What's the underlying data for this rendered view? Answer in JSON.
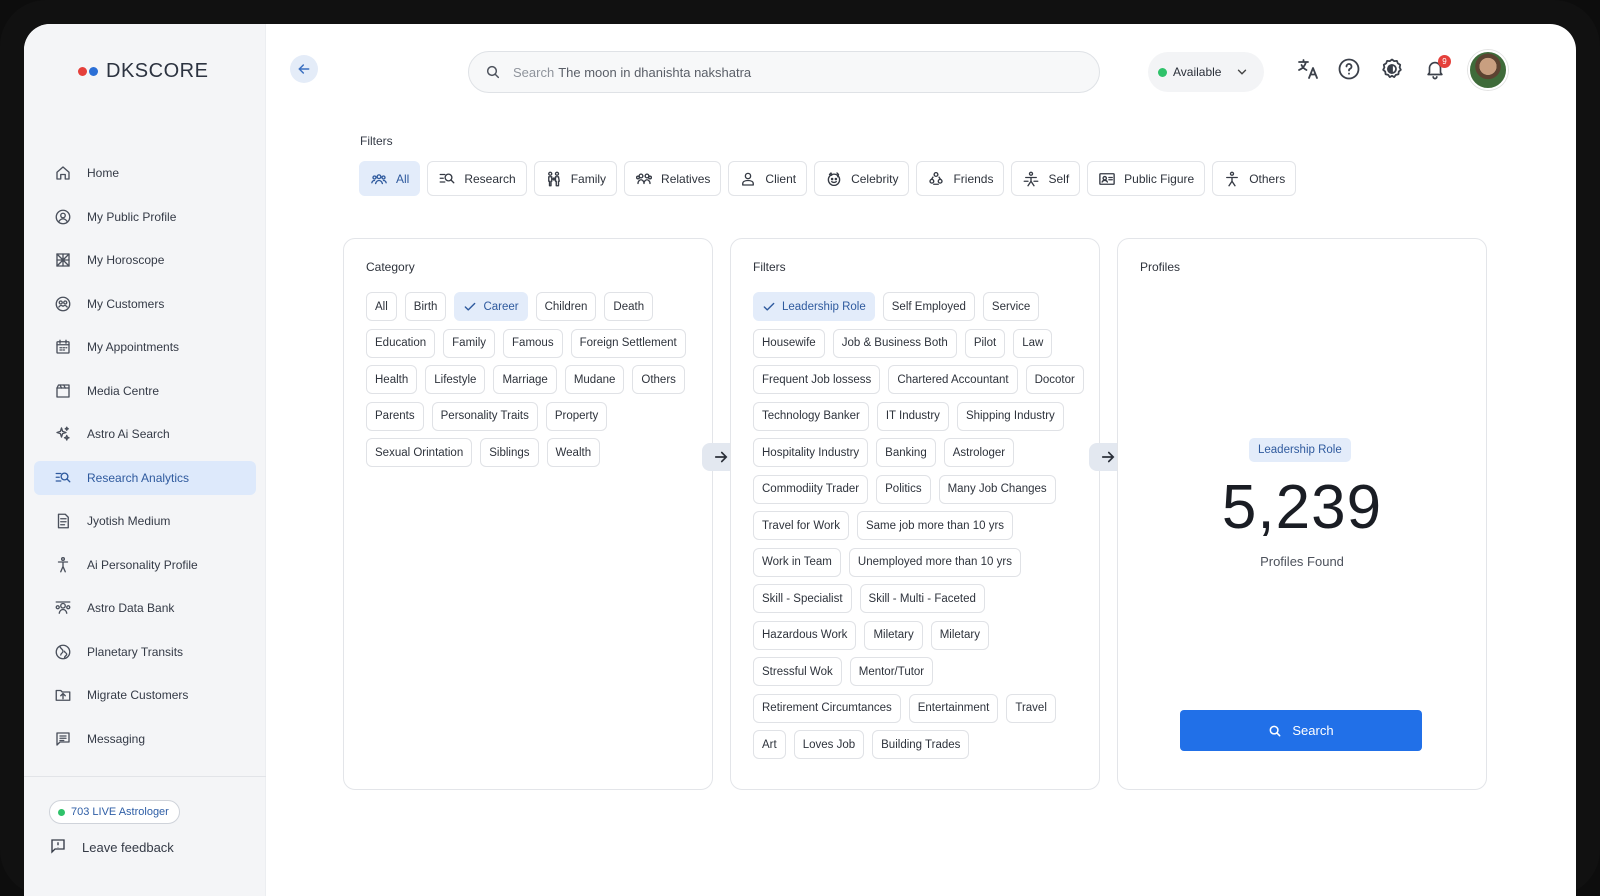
{
  "brand": {
    "name": "DKSCORE",
    "colors": [
      "#e5403b",
      "#2b6fd6"
    ]
  },
  "sidebar": {
    "items": [
      {
        "label": "Home",
        "icon": "home-icon",
        "active": false
      },
      {
        "label": "My Public Profile",
        "icon": "user-circle-icon",
        "active": false
      },
      {
        "label": "My Horoscope",
        "icon": "horoscope-grid-icon",
        "active": false
      },
      {
        "label": "My Customers",
        "icon": "customers-icon",
        "active": false
      },
      {
        "label": "My Appointments",
        "icon": "calendar-icon",
        "active": false
      },
      {
        "label": "Media Centre",
        "icon": "clapperboard-icon",
        "active": false
      },
      {
        "label": "Astro Ai Search",
        "icon": "sparkles-icon",
        "active": false
      },
      {
        "label": "Research Analytics",
        "icon": "research-search-icon",
        "active": true
      },
      {
        "label": "Jyotish Medium",
        "icon": "document-icon",
        "active": false
      },
      {
        "label": "Ai Personality Profile",
        "icon": "person-standing-icon",
        "active": false
      },
      {
        "label": "Astro Data Bank",
        "icon": "data-bank-icon",
        "active": false
      },
      {
        "label": "Planetary Transits",
        "icon": "globe-icon",
        "active": false
      },
      {
        "label": "Migrate Customers",
        "icon": "folder-upload-icon",
        "active": false
      },
      {
        "label": "Messaging",
        "icon": "message-icon",
        "active": false
      }
    ],
    "live_badge": "703 LIVE Astrologer",
    "feedback": "Leave feedback"
  },
  "topbar": {
    "search_placeholder": "Search",
    "search_query": "The moon in dhanishta nakshatra",
    "status": "Available",
    "notification_count": "9"
  },
  "filters": {
    "label": "Filters",
    "tabs": [
      {
        "label": "All",
        "icon": "users-icon",
        "active": true
      },
      {
        "label": "Research",
        "icon": "research-search-icon",
        "active": false
      },
      {
        "label": "Family",
        "icon": "family-icon",
        "active": false
      },
      {
        "label": "Relatives",
        "icon": "relatives-icon",
        "active": false
      },
      {
        "label": "Client",
        "icon": "client-icon",
        "active": false
      },
      {
        "label": "Celebrity",
        "icon": "celebrity-icon",
        "active": false
      },
      {
        "label": "Friends",
        "icon": "friends-icon",
        "active": false
      },
      {
        "label": "Self",
        "icon": "self-icon",
        "active": false
      },
      {
        "label": "Public Figure",
        "icon": "id-card-icon",
        "active": false
      },
      {
        "label": "Others",
        "icon": "others-icon",
        "active": false
      }
    ]
  },
  "category_panel": {
    "title": "Category",
    "chips": [
      {
        "label": "All",
        "selected": false
      },
      {
        "label": "Birth",
        "selected": false
      },
      {
        "label": "Career",
        "selected": true
      },
      {
        "label": "Children",
        "selected": false
      },
      {
        "label": "Death",
        "selected": false
      },
      {
        "label": "Education",
        "selected": false
      },
      {
        "label": "Family",
        "selected": false
      },
      {
        "label": "Famous",
        "selected": false
      },
      {
        "label": "Foreign Settlement",
        "selected": false
      },
      {
        "label": "Health",
        "selected": false
      },
      {
        "label": "Lifestyle",
        "selected": false
      },
      {
        "label": "Marriage",
        "selected": false
      },
      {
        "label": "Mudane",
        "selected": false
      },
      {
        "label": "Others",
        "selected": false
      },
      {
        "label": "Parents",
        "selected": false
      },
      {
        "label": "Personality Traits",
        "selected": false
      },
      {
        "label": "Property",
        "selected": false
      },
      {
        "label": "Sexual Orintation",
        "selected": false
      },
      {
        "label": "Siblings",
        "selected": false
      },
      {
        "label": "Wealth",
        "selected": false
      }
    ]
  },
  "filters_panel": {
    "title": "Filters",
    "chips": [
      {
        "label": "Leadership Role",
        "selected": true
      },
      {
        "label": "Self Employed",
        "selected": false
      },
      {
        "label": "Service",
        "selected": false
      },
      {
        "label": "Housewife",
        "selected": false
      },
      {
        "label": "Job & Business Both",
        "selected": false
      },
      {
        "label": "Pilot",
        "selected": false
      },
      {
        "label": "Law",
        "selected": false
      },
      {
        "label": "Frequent Job lossess",
        "selected": false
      },
      {
        "label": "Chartered Accountant",
        "selected": false
      },
      {
        "label": "Docotor",
        "selected": false
      },
      {
        "label": "Technology Banker",
        "selected": false
      },
      {
        "label": "IT Industry",
        "selected": false
      },
      {
        "label": "Shipping Industry",
        "selected": false
      },
      {
        "label": "Hospitality Industry",
        "selected": false
      },
      {
        "label": "Banking",
        "selected": false
      },
      {
        "label": "Astrologer",
        "selected": false
      },
      {
        "label": "Commodiity Trader",
        "selected": false
      },
      {
        "label": "Politics",
        "selected": false
      },
      {
        "label": "Many Job Changes",
        "selected": false
      },
      {
        "label": "Travel for Work",
        "selected": false
      },
      {
        "label": "Same job more than 10 yrs",
        "selected": false
      },
      {
        "label": "Work in Team",
        "selected": false
      },
      {
        "label": "Unemployed more than 10 yrs",
        "selected": false
      },
      {
        "label": "Skill - Specialist",
        "selected": false
      },
      {
        "label": "Skill - Multi - Faceted",
        "selected": false
      },
      {
        "label": "Hazardous Work",
        "selected": false
      },
      {
        "label": "Miletary",
        "selected": false
      },
      {
        "label": "Miletary",
        "selected": false
      },
      {
        "label": "Stressful Wok",
        "selected": false
      },
      {
        "label": "Mentor/Tutor",
        "selected": false
      },
      {
        "label": "Retirement Circumtances",
        "selected": false
      },
      {
        "label": "Entertainment",
        "selected": false
      },
      {
        "label": "Travel",
        "selected": false
      },
      {
        "label": "Art",
        "selected": false
      },
      {
        "label": "Loves Job",
        "selected": false
      },
      {
        "label": "Building Trades",
        "selected": false
      }
    ]
  },
  "profiles_panel": {
    "title": "Profiles",
    "selected_filter": "Leadership Role",
    "count": "5,239",
    "count_label": "Profiles Found",
    "search_button": "Search"
  }
}
